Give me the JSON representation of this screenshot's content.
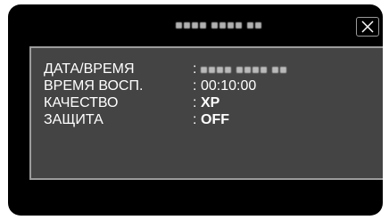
{
  "header": {
    "date_text": "",
    "close_icon": "close-icon"
  },
  "info": {
    "rows": [
      {
        "label": "ДАТА/ВРЕМЯ",
        "separator": ":",
        "value": ""
      },
      {
        "label": "ВРЕМЯ ВОСП.",
        "separator": ":",
        "value": "00:10:00"
      },
      {
        "label": "КАЧЕСТВО",
        "separator": ":",
        "value": "XP"
      },
      {
        "label": "ЗАЩИТА",
        "separator": ":",
        "value": "OFF"
      }
    ]
  },
  "colors": {
    "screen_bg": "#000000",
    "panel_bg": "#444444",
    "panel_border": "#9c9c9c",
    "text": "#ffffff"
  }
}
